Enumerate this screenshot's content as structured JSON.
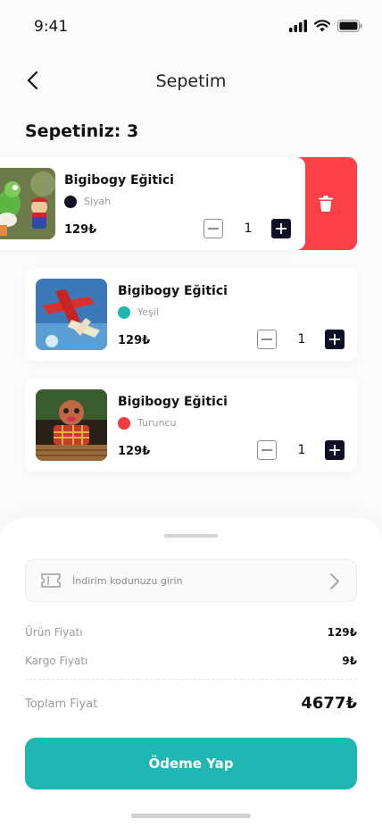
{
  "status_bar": {
    "time": "9:41"
  },
  "header": {
    "title": "Sepetim"
  },
  "cart": {
    "count_text": "Sepetiniz: 3"
  },
  "items": [
    {
      "name": "Bigibogy Eğitici",
      "color_name": "Siyah",
      "color_hex": "#0f1026",
      "price": "129₺",
      "quantity": "1"
    },
    {
      "name": "Bigibogy Eğitici",
      "color_name": "Yeşil",
      "color_hex": "#20b7b2",
      "price": "129₺",
      "quantity": "1"
    },
    {
      "name": "Bigibogy Eğitici",
      "color_name": "Turuncu",
      "color_hex": "#f23c3f",
      "price": "129₺",
      "quantity": "1"
    }
  ],
  "summary": {
    "coupon_placeholder": "İndirim kodunuzu girin",
    "product_price_label": "Ürün Fiyatı",
    "product_price_value": "129₺",
    "shipping_label": "Kargo Fiyatı",
    "shipping_value": "9₺",
    "total_label": "Toplam Fiyat",
    "total_value": "4677₺"
  },
  "checkout": {
    "button_label": "Ödeme Yap"
  },
  "colors": {
    "accent": "#20b7b2",
    "danger": "#fb4048",
    "dark": "#0f1026"
  }
}
